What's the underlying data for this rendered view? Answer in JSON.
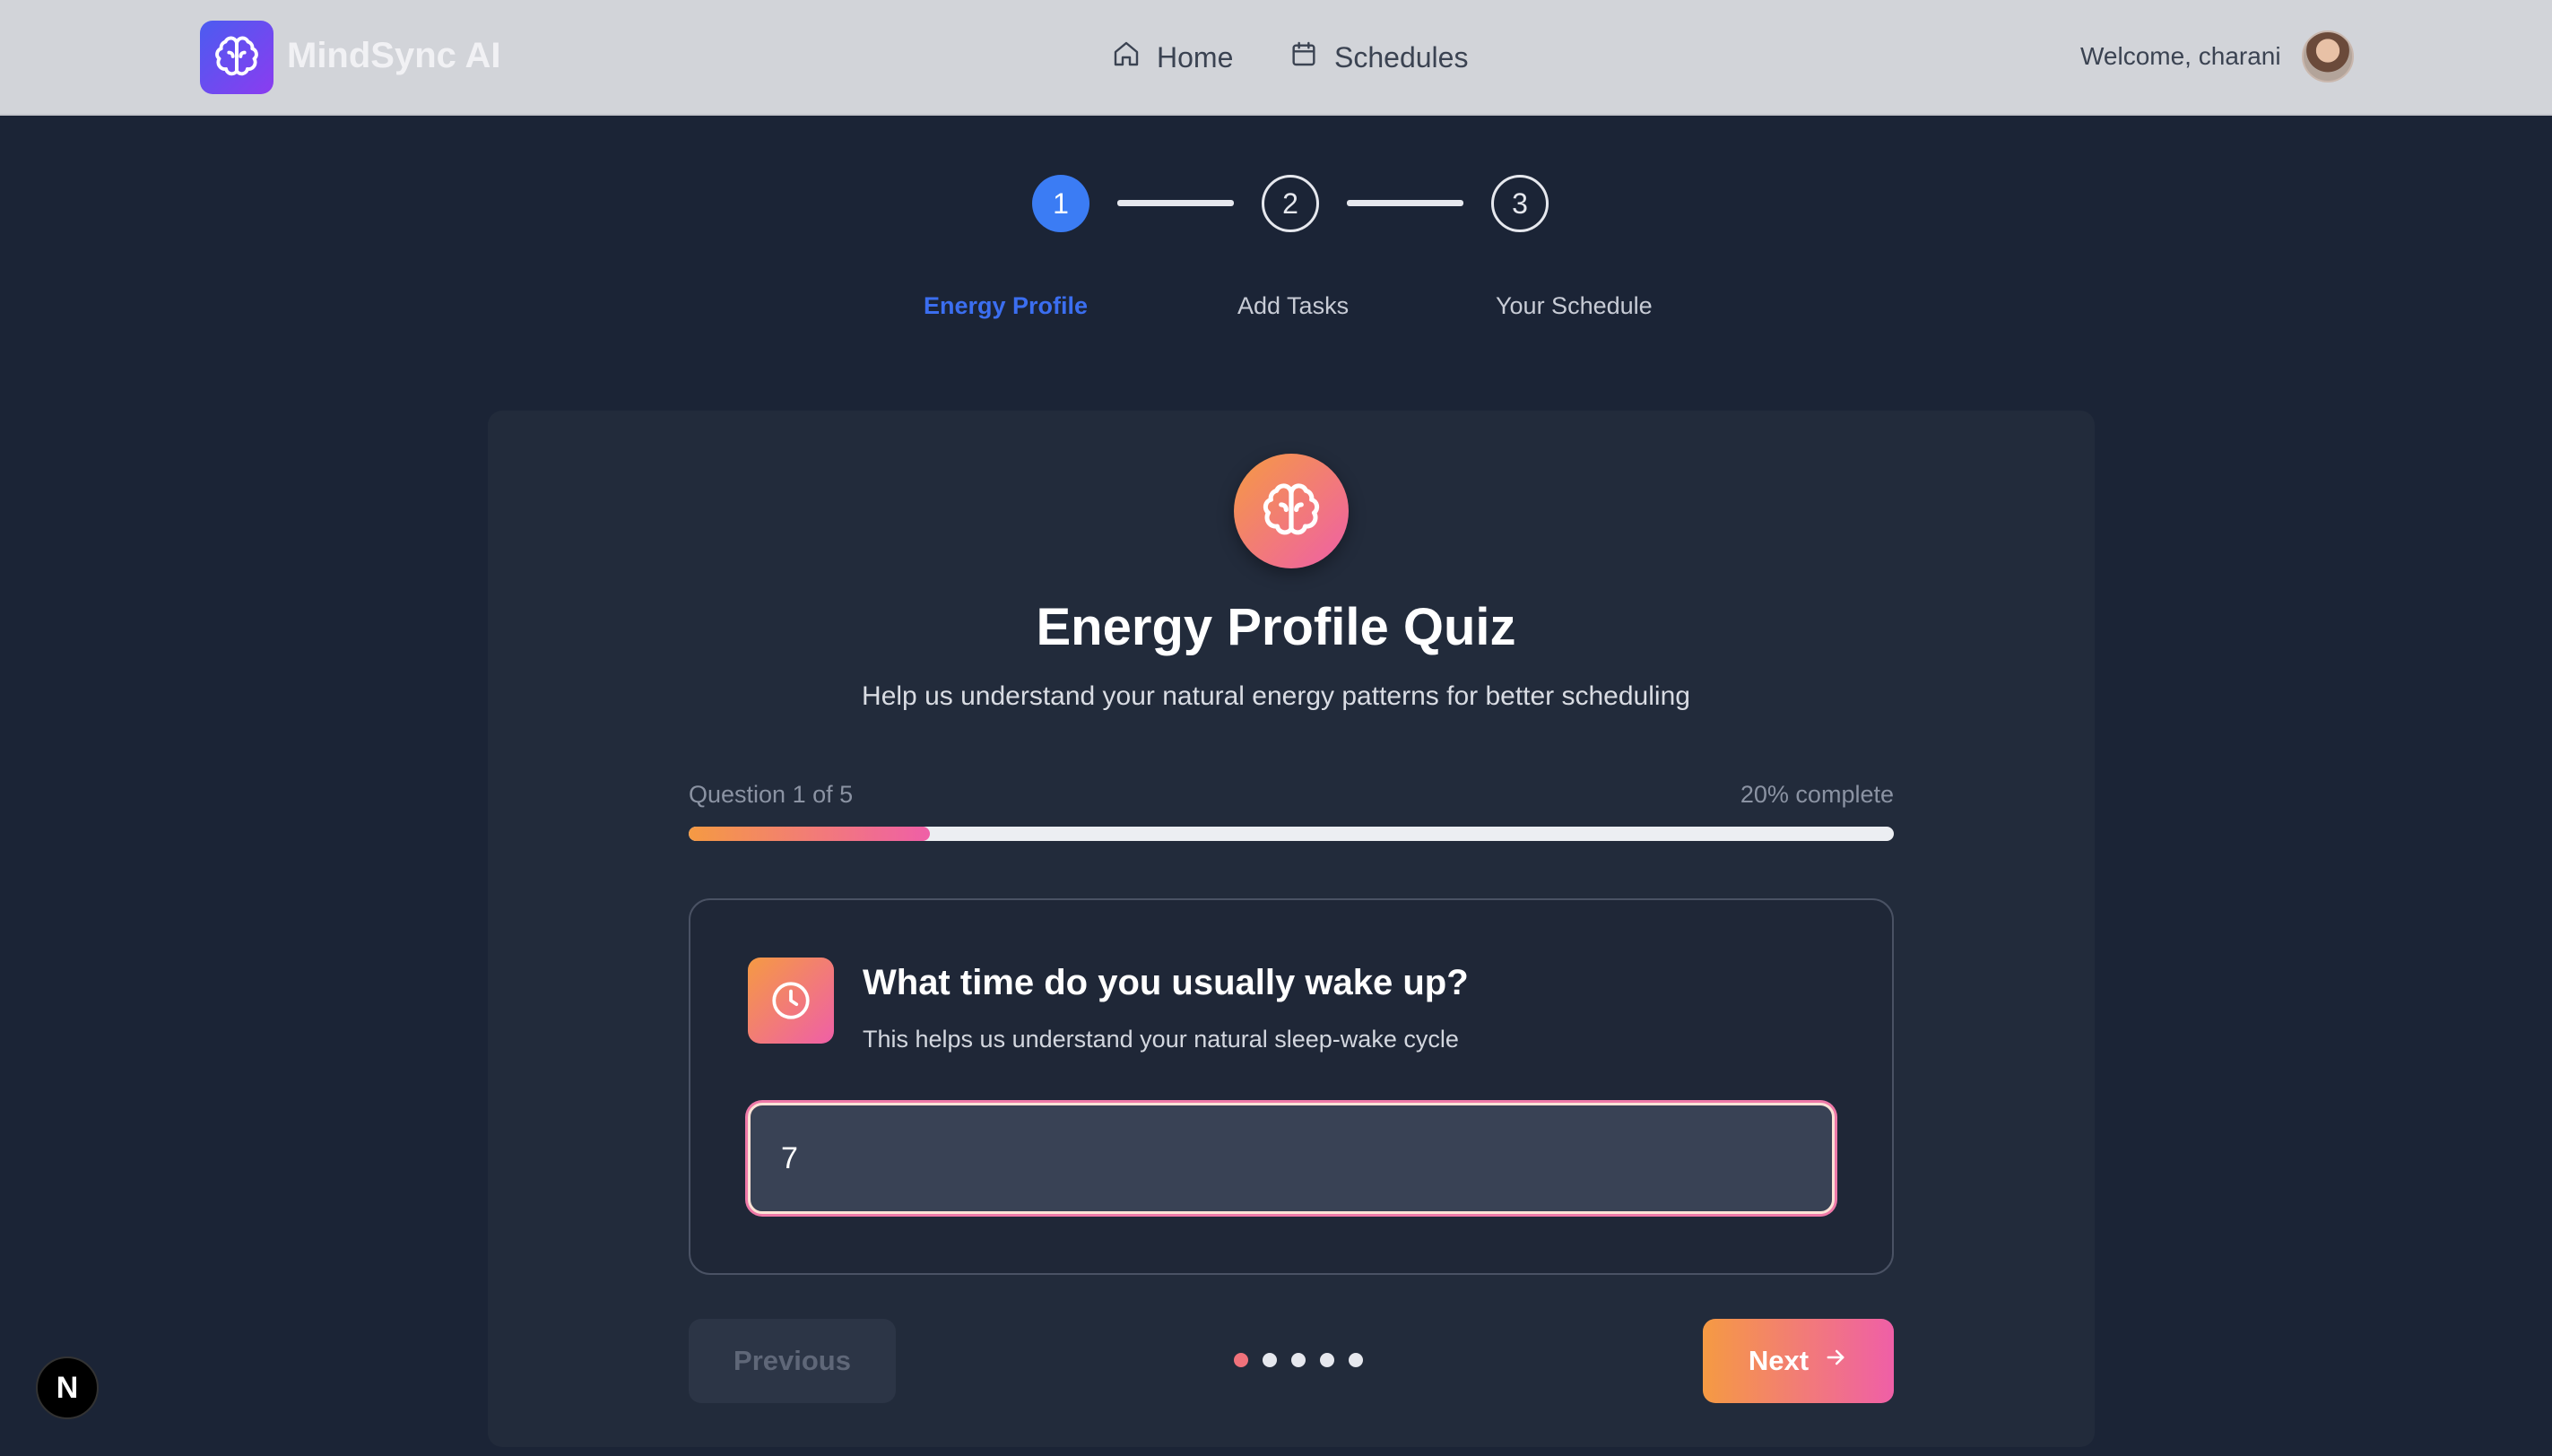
{
  "header": {
    "app_name": "MindSync AI",
    "nav": [
      {
        "label": "Home",
        "icon": "home-icon"
      },
      {
        "label": "Schedules",
        "icon": "calendar-icon"
      }
    ],
    "welcome_text": "Welcome, charani"
  },
  "stepper": {
    "steps": [
      {
        "number": "1",
        "label": "Energy Profile",
        "state": "active"
      },
      {
        "number": "2",
        "label": "Add Tasks",
        "state": "pending"
      },
      {
        "number": "3",
        "label": "Your Schedule",
        "state": "pending"
      }
    ]
  },
  "quiz": {
    "title": "Energy Profile Quiz",
    "subtitle": "Help us understand your natural energy patterns for better scheduling",
    "progress_label": "Question 1 of 5",
    "progress_percent_label": "20% complete",
    "progress_fraction": 0.2,
    "question": {
      "title": "What time do you usually wake up?",
      "description": "This helps us understand your natural sleep-wake cycle",
      "answer_value": "7",
      "icon": "clock-icon"
    },
    "previous_label": "Previous",
    "next_label": "Next",
    "current_dot": 1,
    "total_dots": 5
  },
  "dev_badge": "N",
  "colors": {
    "accent_blue": "#3b7cf4",
    "gradient_start": "#f59a43",
    "gradient_end": "#ef5fa7",
    "background": "#1b2436",
    "card": "#222b3b"
  }
}
